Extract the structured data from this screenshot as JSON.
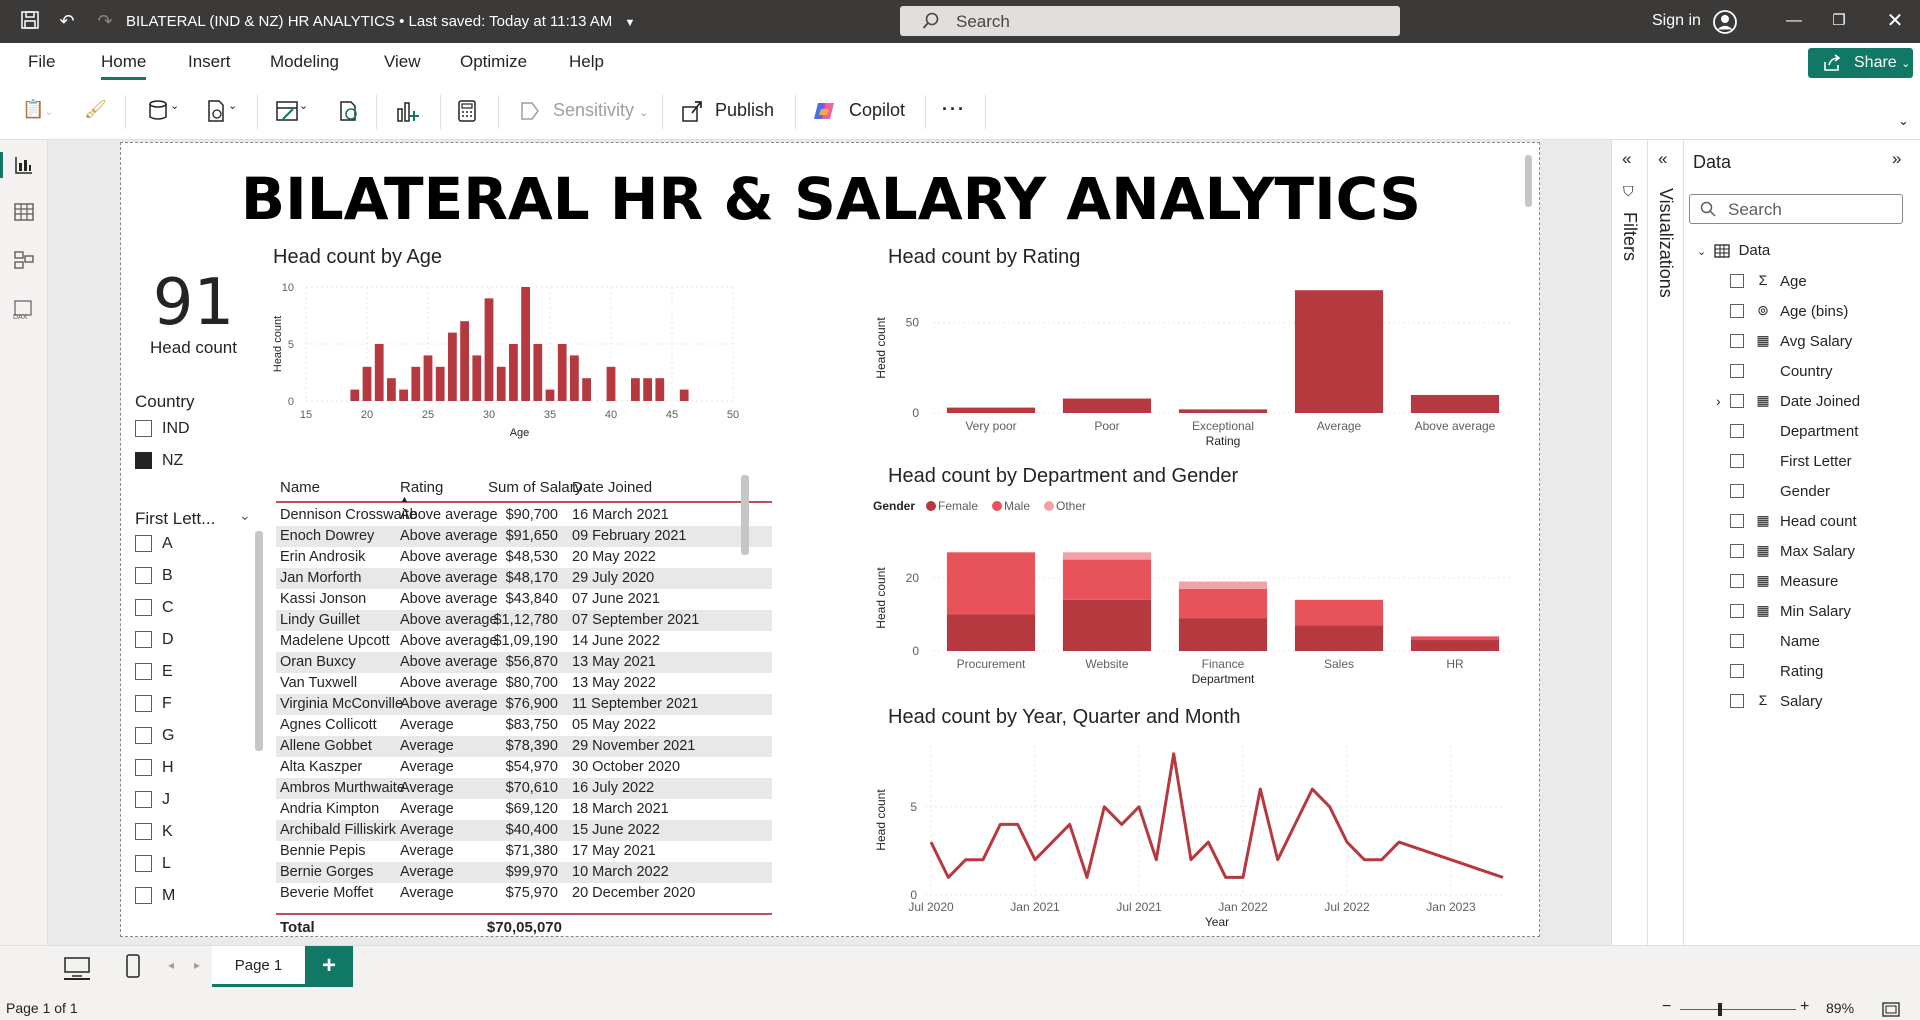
{
  "titlebar": {
    "doc_title": "BILATERAL (IND & NZ) HR ANALYTICS",
    "saved": "• Last saved: Today at 11:13 AM",
    "search_placeholder": "Search",
    "sign_in": "Sign in"
  },
  "menu": {
    "items": [
      "File",
      "Home",
      "Insert",
      "Modeling",
      "View",
      "Optimize",
      "Help"
    ],
    "active": "Home",
    "share": "Share"
  },
  "ribbon": {
    "sensitivity": "Sensitivity",
    "publish": "Publish",
    "copilot": "Copilot",
    "more": "···"
  },
  "report": {
    "title": "BILATERAL HR & SALARY ANALYTICS",
    "kpi": {
      "value": "91",
      "label": "Head count"
    },
    "country_slicer": {
      "title": "Country",
      "items": [
        {
          "label": "IND",
          "checked": false
        },
        {
          "label": "NZ",
          "checked": true
        }
      ]
    },
    "letter_slicer": {
      "title": "First Lett...",
      "items": [
        "A",
        "B",
        "C",
        "D",
        "E",
        "F",
        "G",
        "H",
        "J",
        "K",
        "L",
        "M"
      ]
    },
    "table": {
      "headers": [
        "Name",
        "Rating",
        "Sum of Salary",
        "Date Joined"
      ],
      "rows": [
        [
          "Dennison Crosswaite",
          "Above average",
          "$90,700",
          "16 March 2021"
        ],
        [
          "Enoch Dowrey",
          "Above average",
          "$91,650",
          "09 February 2021"
        ],
        [
          "Erin Androsik",
          "Above average",
          "$48,530",
          "20 May 2022"
        ],
        [
          "Jan Morforth",
          "Above average",
          "$48,170",
          "29 July 2020"
        ],
        [
          "Kassi Jonson",
          "Above average",
          "$43,840",
          "07 June 2021"
        ],
        [
          "Lindy Guillet",
          "Above average",
          "$1,12,780",
          "07 September 2021"
        ],
        [
          "Madelene Upcott",
          "Above average",
          "$1,09,190",
          "14 June 2022"
        ],
        [
          "Oran Buxcy",
          "Above average",
          "$56,870",
          "13 May 2021"
        ],
        [
          "Van Tuxwell",
          "Above average",
          "$80,700",
          "13 May 2022"
        ],
        [
          "Virginia McConville",
          "Above average",
          "$76,900",
          "11 September 2021"
        ],
        [
          "Agnes Collicott",
          "Average",
          "$83,750",
          "05 May 2022"
        ],
        [
          "Allene Gobbet",
          "Average",
          "$78,390",
          "29 November 2021"
        ],
        [
          "Alta Kaszper",
          "Average",
          "$54,970",
          "30 October 2020"
        ],
        [
          "Ambros Murthwaite",
          "Average",
          "$70,610",
          "16 July 2022"
        ],
        [
          "Andria Kimpton",
          "Average",
          "$69,120",
          "18 March 2021"
        ],
        [
          "Archibald Filliskirk",
          "Average",
          "$40,400",
          "15 June 2022"
        ],
        [
          "Bennie Pepis",
          "Average",
          "$71,380",
          "17 May 2021"
        ],
        [
          "Bernie Gorges",
          "Average",
          "$99,970",
          "10 March 2022"
        ],
        [
          "Beverie Moffet",
          "Average",
          "$75,970",
          "20 December 2020"
        ]
      ],
      "total_label": "Total",
      "total_value": "$70,05,070"
    }
  },
  "chart_data": [
    {
      "type": "bar",
      "title": "Head count by Age",
      "xlabel": "Age",
      "ylabel": "Head count",
      "x": [
        19,
        20,
        21,
        22,
        23,
        24,
        25,
        26,
        27,
        28,
        29,
        30,
        31,
        32,
        33,
        34,
        35,
        36,
        37,
        38,
        40,
        42,
        43,
        44,
        46
      ],
      "values": [
        1,
        3,
        5,
        2,
        1,
        3,
        4,
        3,
        6,
        7,
        4,
        9,
        3,
        5,
        10,
        5,
        1,
        5,
        4,
        2,
        3,
        2,
        2,
        2,
        1
      ],
      "xticks": [
        15,
        20,
        25,
        30,
        35,
        40,
        45,
        50
      ],
      "yticks": [
        0,
        5,
        10
      ],
      "xlim": [
        15,
        50
      ],
      "ylim": [
        0,
        10
      ],
      "color": "#b5393e"
    },
    {
      "type": "bar",
      "title": "Head count by Rating",
      "xlabel": "Rating",
      "ylabel": "Head count",
      "categories": [
        "Very poor",
        "Poor",
        "Exceptional",
        "Average",
        "Above average"
      ],
      "values": [
        3,
        8,
        2,
        68,
        10
      ],
      "yticks": [
        0,
        50
      ],
      "ylim": [
        0,
        72
      ],
      "color": "#b5393e"
    },
    {
      "type": "bar",
      "title": "Head count by Department and Gender",
      "xlabel": "Department",
      "ylabel": "Head count",
      "legend_title": "Gender",
      "categories": [
        "Procurement",
        "Website",
        "Finance",
        "Sales",
        "HR"
      ],
      "series": [
        {
          "name": "Female",
          "color": "#b5393e",
          "values": [
            10,
            14,
            9,
            7,
            3
          ]
        },
        {
          "name": "Male",
          "color": "#e8525a",
          "values": [
            17,
            11,
            8,
            7,
            1
          ]
        },
        {
          "name": "Other",
          "color": "#f0a2a6",
          "values": [
            0,
            2,
            2,
            0,
            0
          ]
        }
      ],
      "yticks": [
        0,
        20
      ],
      "ylim": [
        0,
        29
      ]
    },
    {
      "type": "line",
      "title": "Head count by Year, Quarter and Month",
      "xlabel": "Year",
      "ylabel": "Head count",
      "x": [
        "2020-07",
        "2020-08",
        "2020-09",
        "2020-10",
        "2020-11",
        "2020-12",
        "2021-01",
        "2021-02",
        "2021-03",
        "2021-04",
        "2021-05",
        "2021-06",
        "2021-07",
        "2021-08",
        "2021-09",
        "2021-10",
        "2021-11",
        "2021-12",
        "2022-01",
        "2022-02",
        "2022-03",
        "2022-04",
        "2022-05",
        "2022-06",
        "2022-07",
        "2022-08",
        "2022-09",
        "2022-10",
        "2023-04"
      ],
      "values": [
        3,
        1,
        2,
        2,
        4,
        4,
        2,
        3,
        4,
        1,
        5,
        4,
        5,
        2,
        8,
        2,
        3,
        1,
        1,
        6,
        2,
        4,
        6,
        5,
        3,
        2,
        2,
        3,
        1
      ],
      "xticks": [
        "Jul 2020",
        "Jan 2021",
        "Jul 2021",
        "Jan 2022",
        "Jul 2022",
        "Jan 2023"
      ],
      "yticks": [
        0,
        5
      ],
      "ylim": [
        0,
        8.5
      ],
      "color": "#b5393e"
    }
  ],
  "data_pane": {
    "title": "Data",
    "search_placeholder": "Search",
    "table_name": "Data",
    "fields": [
      {
        "name": "Age",
        "icon": "sigma-icon"
      },
      {
        "name": "Age (bins)",
        "icon": "bins-icon"
      },
      {
        "name": "Avg Salary",
        "icon": "calc-icon"
      },
      {
        "name": "Country",
        "icon": ""
      },
      {
        "name": "Date Joined",
        "icon": "calendar-icon",
        "expandable": true
      },
      {
        "name": "Department",
        "icon": ""
      },
      {
        "name": "First Letter",
        "icon": ""
      },
      {
        "name": "Gender",
        "icon": ""
      },
      {
        "name": "Head count",
        "icon": "calc-icon"
      },
      {
        "name": "Max Salary",
        "icon": "calc-icon"
      },
      {
        "name": "Measure",
        "icon": "calc-icon"
      },
      {
        "name": "Min Salary",
        "icon": "calc-icon"
      },
      {
        "name": "Name",
        "icon": ""
      },
      {
        "name": "Rating",
        "icon": ""
      },
      {
        "name": "Salary",
        "icon": "sigma-icon"
      }
    ]
  },
  "panes": {
    "filters": "Filters",
    "visualizations": "Visualizations"
  },
  "bottom": {
    "page_tab": "Page 1",
    "add": "+"
  },
  "status": {
    "page": "Page 1 of 1",
    "zoom": "89%"
  }
}
